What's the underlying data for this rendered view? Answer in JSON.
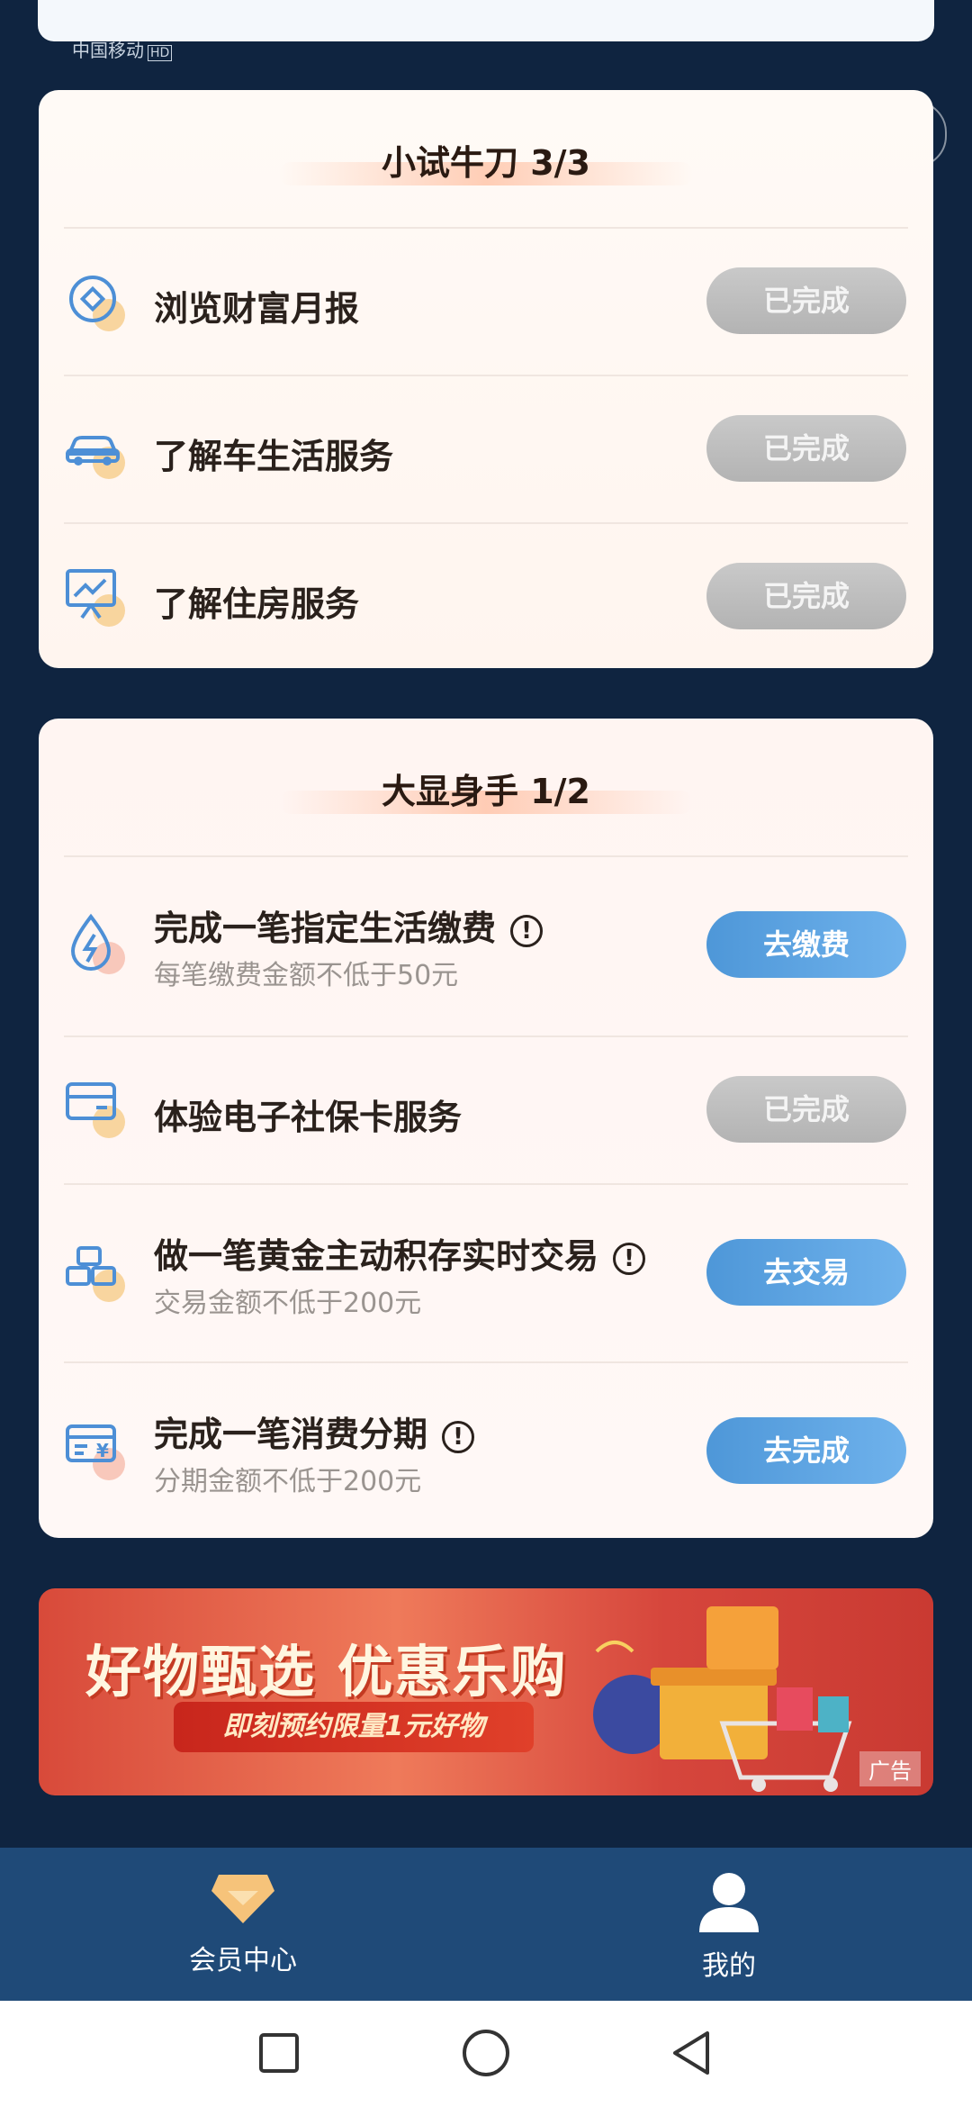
{
  "status_bar": {
    "carrier": "中国移动",
    "hd": "HD"
  },
  "section1": {
    "title": "小试牛刀 3/3",
    "tasks": [
      {
        "title": "浏览财富月报",
        "button": "已完成",
        "icon": "coin-icon"
      },
      {
        "title": "了解车生活服务",
        "button": "已完成",
        "icon": "car-icon"
      },
      {
        "title": "了解住房服务",
        "button": "已完成",
        "icon": "chart-board-icon"
      }
    ]
  },
  "section2": {
    "title": "大显身手 1/2",
    "tasks": [
      {
        "title": "完成一笔指定生活缴费",
        "subtitle": "每笔缴费金额不低于50元",
        "button": "去缴费",
        "icon": "water-drop-icon"
      },
      {
        "title": "体验电子社保卡服务",
        "button": "已完成",
        "icon": "card-icon"
      },
      {
        "title": "做一笔黄金主动积存实时交易",
        "subtitle": "交易金额不低于200元",
        "button": "去交易",
        "icon": "gold-bars-icon"
      },
      {
        "title": "完成一笔消费分期",
        "subtitle": "分期金额不低于200元",
        "button": "去完成",
        "icon": "yuan-card-icon"
      }
    ]
  },
  "banner": {
    "title": "好物甄选 优惠乐购",
    "subtitle": "即刻预约限量1元好物",
    "ad_label": "广告"
  },
  "tabbar": {
    "tabs": [
      {
        "label": "会员中心",
        "icon": "diamond-icon"
      },
      {
        "label": "我的",
        "icon": "person-icon"
      }
    ]
  },
  "colors": {
    "background": "#0f2440",
    "go_button": "#5aa3e2",
    "done_button": "#bdbdbd",
    "tabbar": "#1f4a78"
  }
}
